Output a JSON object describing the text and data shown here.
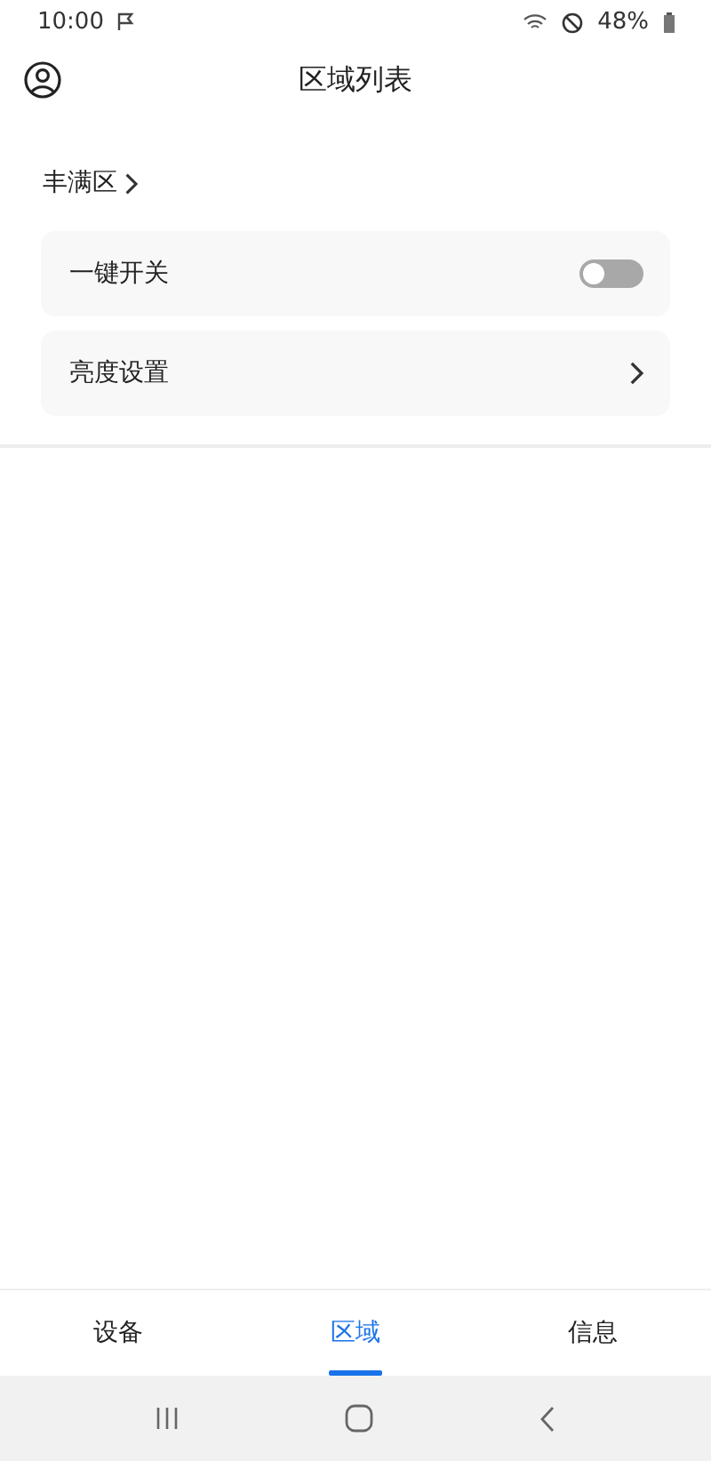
{
  "status_bar": {
    "time": "10:00",
    "battery": "48%"
  },
  "header": {
    "title": "区域列表"
  },
  "zone": {
    "name": "丰满区"
  },
  "settings": [
    {
      "kind": "switch",
      "label": "一键开关",
      "on": false
    },
    {
      "kind": "link",
      "label": "亮度设置"
    }
  ],
  "tabs": [
    {
      "label": "设备",
      "selected": false
    },
    {
      "label": "区域",
      "selected": true
    },
    {
      "label": "信息",
      "selected": false
    }
  ]
}
